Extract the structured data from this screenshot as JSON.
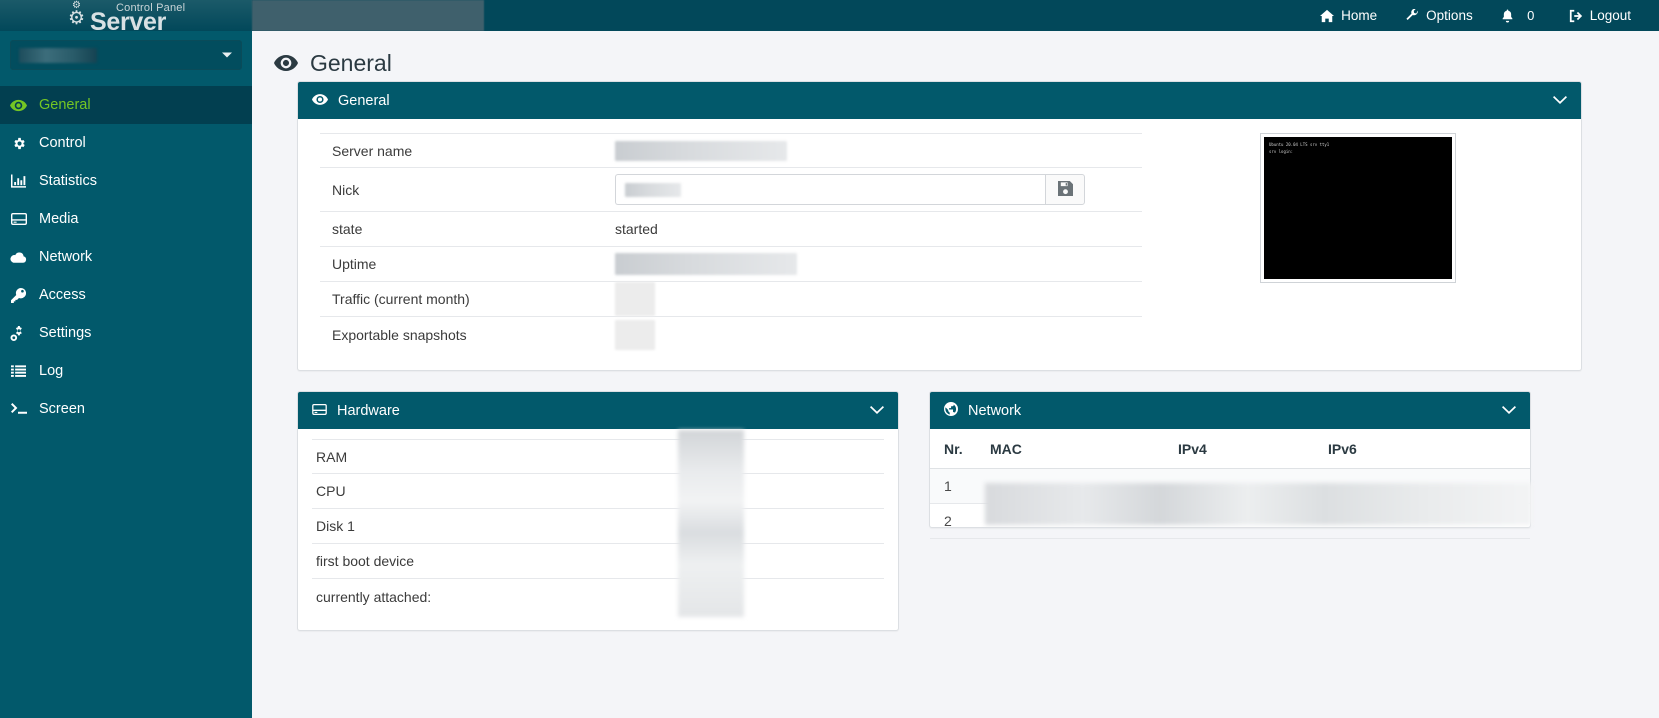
{
  "brand": {
    "sub": "Control Panel",
    "main": "Server",
    "gear_icon": "gear-icon",
    "gear_small_icon": "gear-small-icon"
  },
  "topnav": {
    "items": [
      {
        "label": "Home",
        "icon": "home-icon"
      },
      {
        "label": "Options",
        "icon": "wrench-icon"
      },
      {
        "label": "0",
        "icon": "bell-icon"
      },
      {
        "label": "Logout",
        "icon": "sign-out-icon"
      }
    ]
  },
  "sidebar": {
    "server_select": {
      "value": "",
      "caret_icon": "caret-down-icon"
    },
    "items": [
      {
        "label": "General",
        "icon": "eye-icon",
        "active": true
      },
      {
        "label": "Control",
        "icon": "gear-icon",
        "active": false
      },
      {
        "label": "Statistics",
        "icon": "bar-chart-icon",
        "active": false
      },
      {
        "label": "Media",
        "icon": "hard-drive-icon",
        "active": false
      },
      {
        "label": "Network",
        "icon": "cloud-icon",
        "active": false
      },
      {
        "label": "Access",
        "icon": "key-icon",
        "active": false
      },
      {
        "label": "Settings",
        "icon": "cogs-icon",
        "active": false
      },
      {
        "label": "Log",
        "icon": "list-icon",
        "active": false
      },
      {
        "label": "Screen",
        "icon": "terminal-icon",
        "active": false
      }
    ]
  },
  "page": {
    "title": "General",
    "title_icon": "eye-icon"
  },
  "general_panel": {
    "title": "General",
    "icon": "eye-icon",
    "chevron_icon": "chevron-down-icon",
    "rows": [
      {
        "label": "Server name",
        "value": "",
        "redacted": true
      },
      {
        "label": "Nick",
        "value": "",
        "redacted": true
      },
      {
        "label": "state",
        "value": "started",
        "redacted": false
      },
      {
        "label": "Uptime",
        "value": "",
        "redacted": true
      },
      {
        "label": "Traffic (current month)",
        "value": "",
        "redacted": true
      },
      {
        "label": "Exportable snapshots",
        "value": "",
        "redacted": true
      }
    ],
    "nick_input": {
      "value": "",
      "placeholder": ""
    },
    "save_button": {
      "icon": "floppy-save-icon",
      "label": ""
    },
    "terminal_preview": {
      "line1": "Ubuntu 20.04 LTS srv tty1",
      "line2": "srv login:"
    }
  },
  "hardware_panel": {
    "title": "Hardware",
    "icon": "hard-drive-icon",
    "chevron_icon": "chevron-down-icon",
    "rows": [
      {
        "label": "RAM",
        "value": "",
        "redacted": true
      },
      {
        "label": "CPU",
        "value": "",
        "redacted": true
      },
      {
        "label": "Disk 1",
        "value": "",
        "redacted": true
      },
      {
        "label": "first boot device",
        "value": "",
        "redacted": true
      },
      {
        "label": "currently attached:",
        "value": "",
        "redacted": true
      }
    ]
  },
  "network_panel": {
    "title": "Network",
    "icon": "globe-icon",
    "chevron_icon": "chevron-down-icon",
    "columns": [
      "Nr.",
      "MAC",
      "IPv4",
      "IPv6"
    ],
    "rows": [
      {
        "nr": "1",
        "mac": "",
        "ipv4": "",
        "ipv6": "",
        "redacted": true
      },
      {
        "nr": "2",
        "mac": "",
        "ipv4": "",
        "ipv6": "",
        "redacted": true
      }
    ]
  },
  "colors": {
    "header_teal": "#02485a",
    "sidebar_teal": "#02596b",
    "panel_header_teal": "#02596b",
    "active_green": "#74c624",
    "page_bg": "#f4f5f8"
  }
}
